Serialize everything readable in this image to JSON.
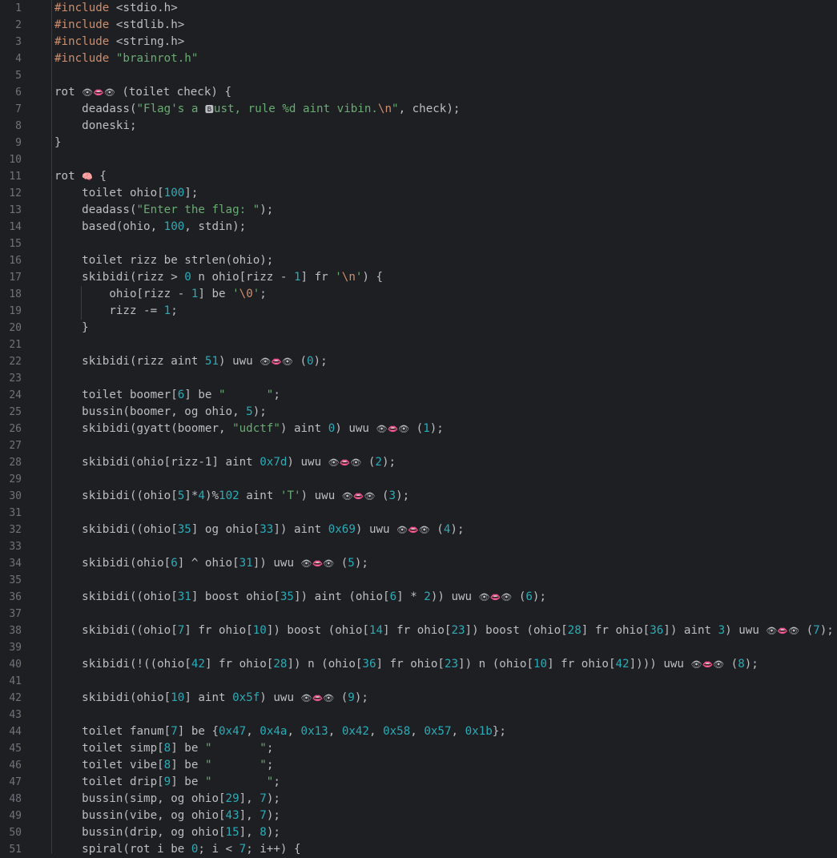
{
  "editor": {
    "line_numbers": [
      "1",
      "2",
      "3",
      "4",
      "5",
      "6",
      "7",
      "8",
      "9",
      "10",
      "11",
      "12",
      "13",
      "14",
      "15",
      "16",
      "17",
      "18",
      "19",
      "20",
      "21",
      "22",
      "23",
      "24",
      "25",
      "26",
      "27",
      "28",
      "29",
      "30",
      "31",
      "32",
      "33",
      "34",
      "35",
      "36",
      "37",
      "38",
      "39",
      "40",
      "41",
      "42",
      "43",
      "44",
      "45",
      "46",
      "47",
      "48",
      "49",
      "50",
      "51"
    ],
    "lines": [
      [
        {
          "t": "#include",
          "c": "kw"
        },
        {
          "t": " <stdio.h>"
        }
      ],
      [
        {
          "t": "#include",
          "c": "kw"
        },
        {
          "t": " <stdlib.h>"
        }
      ],
      [
        {
          "t": "#include",
          "c": "kw"
        },
        {
          "t": " <string.h>"
        }
      ],
      [
        {
          "t": "#include",
          "c": "kw"
        },
        {
          "t": " "
        },
        {
          "t": "\"brainrot.h\"",
          "c": "str"
        }
      ],
      [],
      [
        {
          "t": "rot "
        },
        {
          "t": "👁👄👁",
          "c": "emo"
        },
        {
          "t": " (toilet check) {"
        }
      ],
      [
        {
          "t": "    deadass("
        },
        {
          "t": "\"Flag's a ",
          "c": "str"
        },
        {
          "t": "🅱",
          "c": "emo"
        },
        {
          "t": "ust, rule %d aint vibin.",
          "c": "str"
        },
        {
          "t": "\\n",
          "c": "esc"
        },
        {
          "t": "\"",
          "c": "str"
        },
        {
          "t": ", check);"
        }
      ],
      [
        {
          "t": "    doneski;"
        }
      ],
      [
        {
          "t": "}"
        }
      ],
      [],
      [
        {
          "t": "rot "
        },
        {
          "t": "🧠",
          "c": "emo"
        },
        {
          "t": " {"
        }
      ],
      [
        {
          "t": "    toilet ohio["
        },
        {
          "t": "100",
          "c": "num"
        },
        {
          "t": "];"
        }
      ],
      [
        {
          "t": "    deadass("
        },
        {
          "t": "\"Enter the flag: \"",
          "c": "str"
        },
        {
          "t": ");"
        }
      ],
      [
        {
          "t": "    based(ohio, "
        },
        {
          "t": "100",
          "c": "num"
        },
        {
          "t": ", stdin);"
        }
      ],
      [],
      [
        {
          "t": "    toilet rizz be strlen(ohio);"
        }
      ],
      [
        {
          "t": "    skibidi(rizz > "
        },
        {
          "t": "0",
          "c": "num"
        },
        {
          "t": " n ohio[rizz - "
        },
        {
          "t": "1",
          "c": "num"
        },
        {
          "t": "] fr "
        },
        {
          "t": "'",
          "c": "str"
        },
        {
          "t": "\\n",
          "c": "esc"
        },
        {
          "t": "'",
          "c": "str"
        },
        {
          "t": ") {"
        }
      ],
      [
        {
          "t": "        ohio[rizz - "
        },
        {
          "t": "1",
          "c": "num"
        },
        {
          "t": "] be "
        },
        {
          "t": "'",
          "c": "str"
        },
        {
          "t": "\\0",
          "c": "esc"
        },
        {
          "t": "'",
          "c": "str"
        },
        {
          "t": ";"
        }
      ],
      [
        {
          "t": "        rizz -= "
        },
        {
          "t": "1",
          "c": "num"
        },
        {
          "t": ";"
        }
      ],
      [
        {
          "t": "    }"
        }
      ],
      [],
      [
        {
          "t": "    skibidi(rizz aint "
        },
        {
          "t": "51",
          "c": "num"
        },
        {
          "t": ") uwu "
        },
        {
          "t": "👁👄👁",
          "c": "emo"
        },
        {
          "t": " ("
        },
        {
          "t": "0",
          "c": "num"
        },
        {
          "t": ");"
        }
      ],
      [],
      [
        {
          "t": "    toilet boomer["
        },
        {
          "t": "6",
          "c": "num"
        },
        {
          "t": "] be "
        },
        {
          "t": "\"      \"",
          "c": "str"
        },
        {
          "t": ";"
        }
      ],
      [
        {
          "t": "    bussin(boomer, og ohio, "
        },
        {
          "t": "5",
          "c": "num"
        },
        {
          "t": ");"
        }
      ],
      [
        {
          "t": "    skibidi(gyatt(boomer, "
        },
        {
          "t": "\"udctf\"",
          "c": "str"
        },
        {
          "t": ") aint "
        },
        {
          "t": "0",
          "c": "num"
        },
        {
          "t": ") uwu "
        },
        {
          "t": "👁👄👁",
          "c": "emo"
        },
        {
          "t": " ("
        },
        {
          "t": "1",
          "c": "num"
        },
        {
          "t": ");"
        }
      ],
      [],
      [
        {
          "t": "    skibidi(ohio[rizz-1] aint "
        },
        {
          "t": "0x7d",
          "c": "num"
        },
        {
          "t": ") uwu "
        },
        {
          "t": "👁👄👁",
          "c": "emo"
        },
        {
          "t": " ("
        },
        {
          "t": "2",
          "c": "num"
        },
        {
          "t": ");"
        }
      ],
      [],
      [
        {
          "t": "    skibidi((ohio["
        },
        {
          "t": "5",
          "c": "num"
        },
        {
          "t": "]*"
        },
        {
          "t": "4",
          "c": "num"
        },
        {
          "t": ")%"
        },
        {
          "t": "102",
          "c": "num"
        },
        {
          "t": " aint "
        },
        {
          "t": "'T'",
          "c": "str"
        },
        {
          "t": ") uwu "
        },
        {
          "t": "👁👄👁",
          "c": "emo"
        },
        {
          "t": " ("
        },
        {
          "t": "3",
          "c": "num"
        },
        {
          "t": ");"
        }
      ],
      [],
      [
        {
          "t": "    skibidi((ohio["
        },
        {
          "t": "35",
          "c": "num"
        },
        {
          "t": "] og ohio["
        },
        {
          "t": "33",
          "c": "num"
        },
        {
          "t": "]) aint "
        },
        {
          "t": "0x69",
          "c": "num"
        },
        {
          "t": ") uwu "
        },
        {
          "t": "👁👄👁",
          "c": "emo"
        },
        {
          "t": " ("
        },
        {
          "t": "4",
          "c": "num"
        },
        {
          "t": ");"
        }
      ],
      [],
      [
        {
          "t": "    skibidi(ohio["
        },
        {
          "t": "6",
          "c": "num"
        },
        {
          "t": "] ^ ohio["
        },
        {
          "t": "31",
          "c": "num"
        },
        {
          "t": "]) uwu "
        },
        {
          "t": "👁👄👁",
          "c": "emo"
        },
        {
          "t": " ("
        },
        {
          "t": "5",
          "c": "num"
        },
        {
          "t": ");"
        }
      ],
      [],
      [
        {
          "t": "    skibidi((ohio["
        },
        {
          "t": "31",
          "c": "num"
        },
        {
          "t": "] boost ohio["
        },
        {
          "t": "35",
          "c": "num"
        },
        {
          "t": "]) aint (ohio["
        },
        {
          "t": "6",
          "c": "num"
        },
        {
          "t": "] * "
        },
        {
          "t": "2",
          "c": "num"
        },
        {
          "t": ")) uwu "
        },
        {
          "t": "👁👄👁",
          "c": "emo"
        },
        {
          "t": " ("
        },
        {
          "t": "6",
          "c": "num"
        },
        {
          "t": ");"
        }
      ],
      [],
      [
        {
          "t": "    skibidi((ohio["
        },
        {
          "t": "7",
          "c": "num"
        },
        {
          "t": "] fr ohio["
        },
        {
          "t": "10",
          "c": "num"
        },
        {
          "t": "]) boost (ohio["
        },
        {
          "t": "14",
          "c": "num"
        },
        {
          "t": "] fr ohio["
        },
        {
          "t": "23",
          "c": "num"
        },
        {
          "t": "]) boost (ohio["
        },
        {
          "t": "28",
          "c": "num"
        },
        {
          "t": "] fr ohio["
        },
        {
          "t": "36",
          "c": "num"
        },
        {
          "t": "]) aint "
        },
        {
          "t": "3",
          "c": "num"
        },
        {
          "t": ") uwu "
        },
        {
          "t": "👁👄👁",
          "c": "emo"
        },
        {
          "t": " ("
        },
        {
          "t": "7",
          "c": "num"
        },
        {
          "t": ");"
        }
      ],
      [],
      [
        {
          "t": "    skibidi(!((ohio["
        },
        {
          "t": "42",
          "c": "num"
        },
        {
          "t": "] fr ohio["
        },
        {
          "t": "28",
          "c": "num"
        },
        {
          "t": "]) n (ohio["
        },
        {
          "t": "36",
          "c": "num"
        },
        {
          "t": "] fr ohio["
        },
        {
          "t": "23",
          "c": "num"
        },
        {
          "t": "]) n (ohio["
        },
        {
          "t": "10",
          "c": "num"
        },
        {
          "t": "] fr ohio["
        },
        {
          "t": "42",
          "c": "num"
        },
        {
          "t": "]))) uwu "
        },
        {
          "t": "👁👄👁",
          "c": "emo"
        },
        {
          "t": " ("
        },
        {
          "t": "8",
          "c": "num"
        },
        {
          "t": ");"
        }
      ],
      [],
      [
        {
          "t": "    skibidi(ohio["
        },
        {
          "t": "10",
          "c": "num"
        },
        {
          "t": "] aint "
        },
        {
          "t": "0x5f",
          "c": "num"
        },
        {
          "t": ") uwu "
        },
        {
          "t": "👁👄👁",
          "c": "emo"
        },
        {
          "t": " ("
        },
        {
          "t": "9",
          "c": "num"
        },
        {
          "t": ");"
        }
      ],
      [],
      [
        {
          "t": "    toilet fanum["
        },
        {
          "t": "7",
          "c": "num"
        },
        {
          "t": "] be {"
        },
        {
          "t": "0x47",
          "c": "num"
        },
        {
          "t": ", "
        },
        {
          "t": "0x4a",
          "c": "num"
        },
        {
          "t": ", "
        },
        {
          "t": "0x13",
          "c": "num"
        },
        {
          "t": ", "
        },
        {
          "t": "0x42",
          "c": "num"
        },
        {
          "t": ", "
        },
        {
          "t": "0x58",
          "c": "num"
        },
        {
          "t": ", "
        },
        {
          "t": "0x57",
          "c": "num"
        },
        {
          "t": ", "
        },
        {
          "t": "0x1b",
          "c": "num"
        },
        {
          "t": "};"
        }
      ],
      [
        {
          "t": "    toilet simp["
        },
        {
          "t": "8",
          "c": "num"
        },
        {
          "t": "] be "
        },
        {
          "t": "\"       \"",
          "c": "str"
        },
        {
          "t": ";"
        }
      ],
      [
        {
          "t": "    toilet vibe["
        },
        {
          "t": "8",
          "c": "num"
        },
        {
          "t": "] be "
        },
        {
          "t": "\"       \"",
          "c": "str"
        },
        {
          "t": ";"
        }
      ],
      [
        {
          "t": "    toilet drip["
        },
        {
          "t": "9",
          "c": "num"
        },
        {
          "t": "] be "
        },
        {
          "t": "\"        \"",
          "c": "str"
        },
        {
          "t": ";"
        }
      ],
      [
        {
          "t": "    bussin(simp, og ohio["
        },
        {
          "t": "29",
          "c": "num"
        },
        {
          "t": "], "
        },
        {
          "t": "7",
          "c": "num"
        },
        {
          "t": ");"
        }
      ],
      [
        {
          "t": "    bussin(vibe, og ohio["
        },
        {
          "t": "43",
          "c": "num"
        },
        {
          "t": "], "
        },
        {
          "t": "7",
          "c": "num"
        },
        {
          "t": ");"
        }
      ],
      [
        {
          "t": "    bussin(drip, og ohio["
        },
        {
          "t": "15",
          "c": "num"
        },
        {
          "t": "], "
        },
        {
          "t": "8",
          "c": "num"
        },
        {
          "t": ");"
        }
      ],
      [
        {
          "t": "    spiral(rot i be "
        },
        {
          "t": "0",
          "c": "num"
        },
        {
          "t": "; i < "
        },
        {
          "t": "7",
          "c": "num"
        },
        {
          "t": "; i++) {"
        }
      ]
    ],
    "colors": {
      "background": "#1e1f22",
      "default_text": "#bcbec4",
      "keyword": "#cf8e6d",
      "string": "#6aab73",
      "number": "#2aacb8",
      "line_number": "#6f737a"
    }
  }
}
